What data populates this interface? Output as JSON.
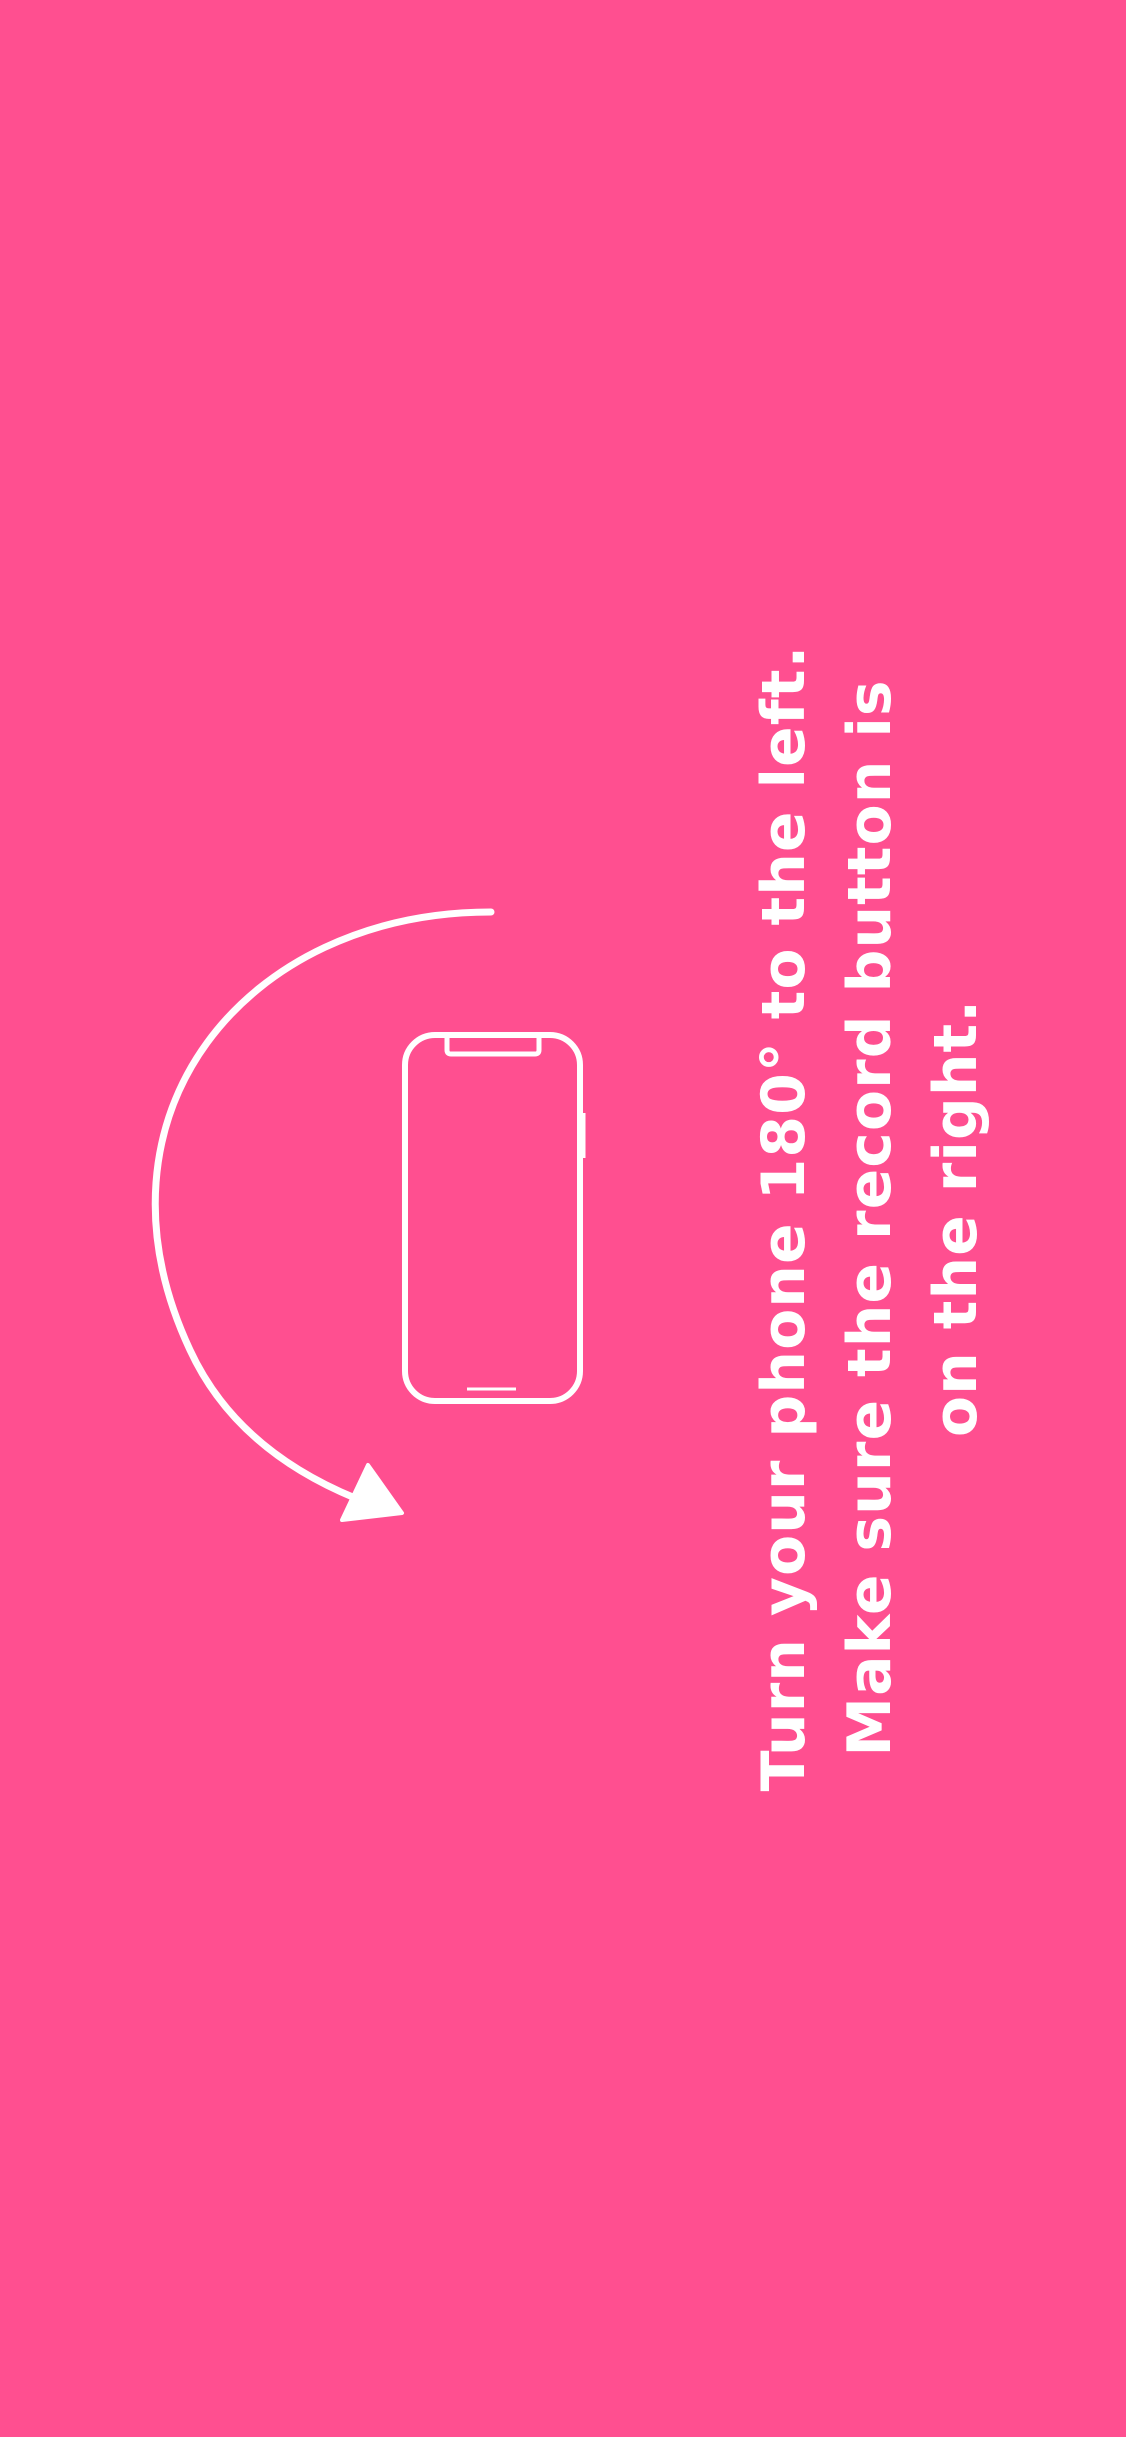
{
  "screen": {
    "background_color": "#ff4f90",
    "foreground_color": "#ffffff"
  },
  "instructions": {
    "line1": "Turn your phone 180° to the left.",
    "line2": "Make sure the record button is",
    "line3": "on the right."
  },
  "icons": {
    "phone": "phone-outline-icon",
    "arrow": "rotate-arrow-icon"
  }
}
